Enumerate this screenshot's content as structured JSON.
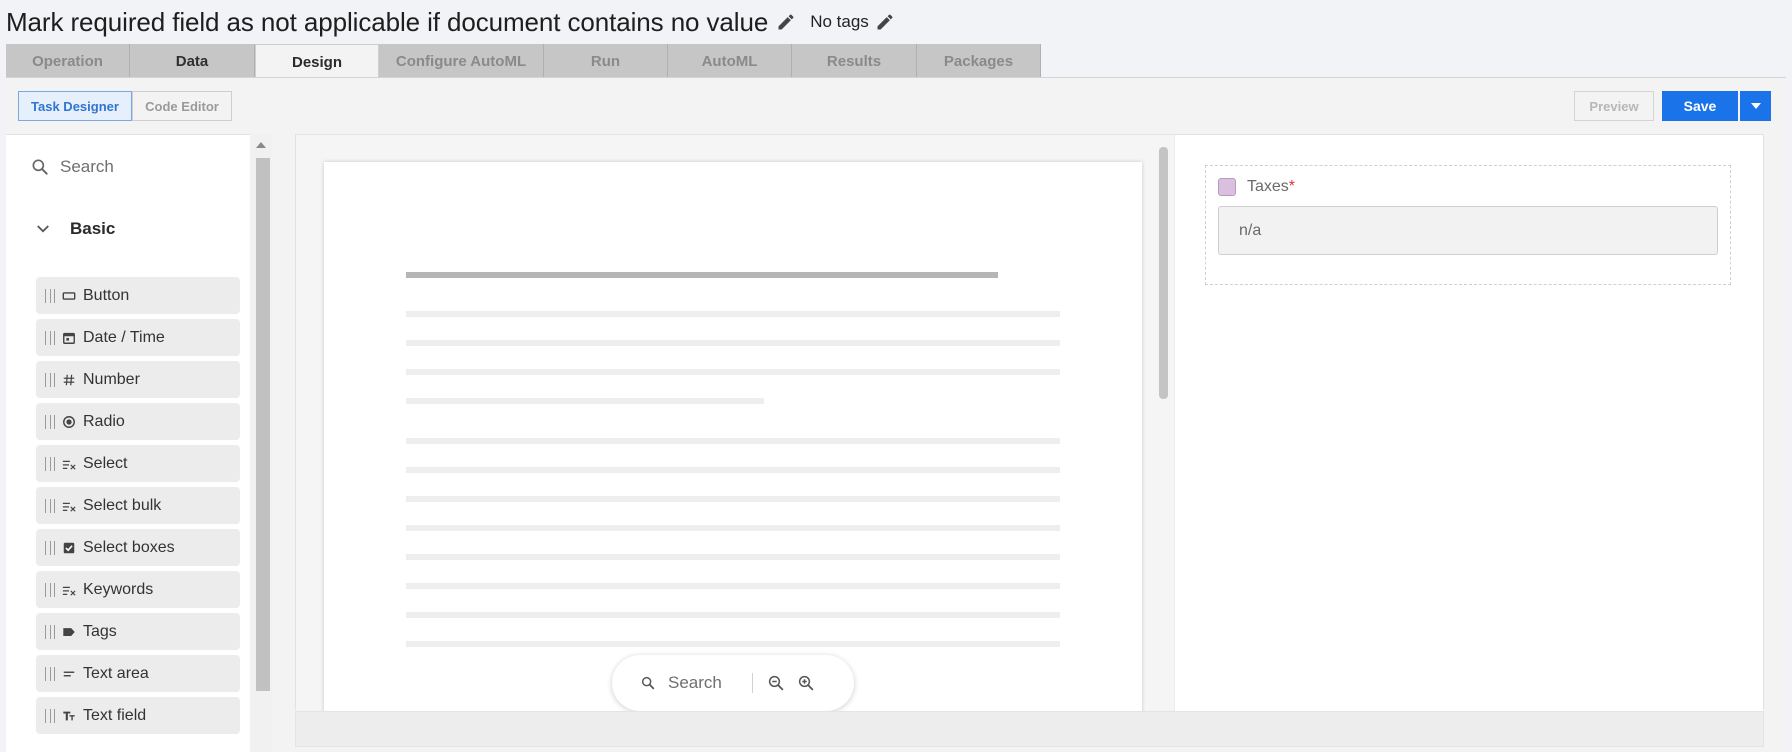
{
  "header": {
    "title": "Mark required field as not applicable if document contains no value",
    "tags_label": "No tags",
    "edit_icon": "pencil-icon"
  },
  "tabs": [
    {
      "label": "Operation"
    },
    {
      "label": "Data"
    },
    {
      "label": "Design"
    },
    {
      "label": "Configure AutoML"
    },
    {
      "label": "Run"
    },
    {
      "label": "AutoML"
    },
    {
      "label": "Results"
    },
    {
      "label": "Packages"
    }
  ],
  "active_tab": "Design",
  "toolbar": {
    "task_designer": "Task Designer",
    "code_editor": "Code Editor",
    "preview": "Preview",
    "save": "Save"
  },
  "palette": {
    "search_placeholder": "Search",
    "group": "Basic",
    "items": [
      {
        "label": "Button",
        "icon": "button-icon"
      },
      {
        "label": "Date / Time",
        "icon": "calendar-icon"
      },
      {
        "label": "Number",
        "icon": "hash-icon"
      },
      {
        "label": "Radio",
        "icon": "radio-icon"
      },
      {
        "label": "Select",
        "icon": "select-list-icon"
      },
      {
        "label": "Select bulk",
        "icon": "select-list-icon"
      },
      {
        "label": "Select boxes",
        "icon": "checkbox-icon"
      },
      {
        "label": "Keywords",
        "icon": "select-list-icon"
      },
      {
        "label": "Tags",
        "icon": "tag-icon"
      },
      {
        "label": "Text area",
        "icon": "text-area-icon"
      },
      {
        "label": "Text field",
        "icon": "text-field-icon"
      }
    ]
  },
  "document": {
    "search_placeholder": "Search"
  },
  "form": {
    "field_label": "Taxes",
    "required_mark": "*",
    "field_value": "n/a"
  },
  "colors": {
    "primary": "#1a73e8",
    "checkbox": "#d9c0df",
    "required": "#dd3333"
  }
}
